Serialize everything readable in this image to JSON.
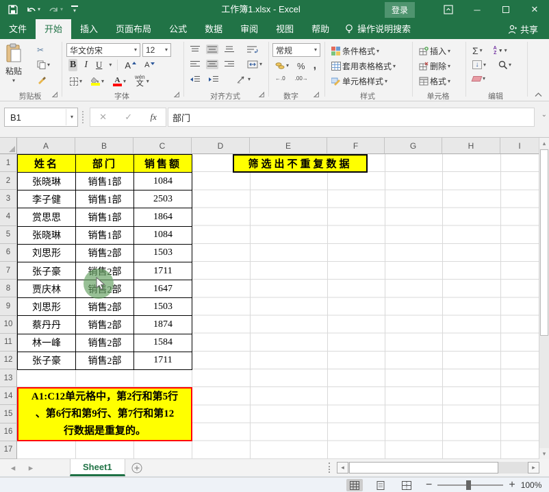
{
  "colors": {
    "brand_green": "#217346",
    "active_tab_text": "#217346",
    "cell_yellow": "#FFFF00",
    "note_border_red": "#FF0000",
    "click_indicator_green": "#62A060",
    "font_color_red": "#FF0000",
    "fill_color_yellow": "#FFFF00"
  },
  "icons": {
    "dropdown": "▾",
    "scissors": "✂",
    "cancel": "✕",
    "check": "✓",
    "sum": "Σ",
    "fill_down": "↓",
    "comma": ",",
    "percent": "%",
    "dec_increase": "←.0",
    "dec_decrease": ".00→",
    "prev_sheet": "◂",
    "next_sheet": "▸",
    "scroll_up": "▴",
    "scroll_down": "▾",
    "scroll_left": "◂",
    "scroll_right": "▸",
    "add_sheet": "+",
    "minimize": "─",
    "close": "✕",
    "formula_expand": "⌄",
    "zoom_out": "−",
    "zoom_in": "+",
    "sort_a": "A",
    "sort_z": "Z",
    "sort_arrow": "▼"
  },
  "title_bar": {
    "title": "工作簿1.xlsx - Excel",
    "login_label": "登录"
  },
  "menu": {
    "tabs": [
      "文件",
      "开始",
      "插入",
      "页面布局",
      "公式",
      "数据",
      "审阅",
      "视图",
      "帮助"
    ],
    "active_tab": "开始",
    "search_label": "操作说明搜索",
    "share_label": "共享"
  },
  "ribbon": {
    "paste_label": "粘贴",
    "font_name": "华文仿宋",
    "font_size": "12",
    "bold_label": "B",
    "italic_label": "I",
    "underline_label": "U",
    "grow_font_label": "A",
    "shrink_font_label": "A",
    "font_color_label": "A",
    "pinyin_ruby": "wén",
    "pinyin_label": "文",
    "number_format": "常规",
    "styles_items": [
      "条件格式",
      "套用表格格式",
      "单元格样式"
    ],
    "cells_items": [
      "插入",
      "删除",
      "格式"
    ],
    "groups": {
      "clipboard": "剪贴板",
      "font": "字体",
      "alignment": "对齐方式",
      "number": "数字",
      "styles": "样式",
      "cells": "单元格",
      "editing": "编辑"
    }
  },
  "formula_bar": {
    "name_box": "B1",
    "fx": "fx",
    "content": "部门"
  },
  "sheet": {
    "columns": [
      "A",
      "B",
      "C",
      "D",
      "E",
      "F",
      "G",
      "H",
      "I"
    ],
    "row_numbers": [
      "1",
      "2",
      "3",
      "4",
      "5",
      "6",
      "7",
      "8",
      "9",
      "10",
      "11",
      "12",
      "13",
      "14",
      "15",
      "16",
      "17"
    ],
    "banner": "筛选出不重复数据",
    "table": {
      "headers": [
        "姓名",
        "部门",
        "销售额"
      ],
      "rows": [
        [
          "张晓琳",
          "销售1部",
          "1084"
        ],
        [
          "李子健",
          "销售1部",
          "2503"
        ],
        [
          "赏思思",
          "销售1部",
          "1864"
        ],
        [
          "张晓琳",
          "销售1部",
          "1084"
        ],
        [
          "刘思形",
          "销售2部",
          "1503"
        ],
        [
          "张子豪",
          "销售2部",
          "1711"
        ],
        [
          "贾庆林",
          "销售2部",
          "1647"
        ],
        [
          "刘思形",
          "销售2部",
          "1503"
        ],
        [
          "蔡丹丹",
          "销售2部",
          "1874"
        ],
        [
          "林一峰",
          "销售2部",
          "1584"
        ],
        [
          "张子豪",
          "销售2部",
          "1711"
        ]
      ]
    },
    "note_lines": [
      "A1:C12单元格中，第2行和第5行",
      "、第6行和第9行、第7行和第12",
      "行数据是重复的。"
    ]
  },
  "tabs_bar": {
    "sheet_name": "Sheet1"
  },
  "status_bar": {
    "zoom_level": "100%"
  }
}
